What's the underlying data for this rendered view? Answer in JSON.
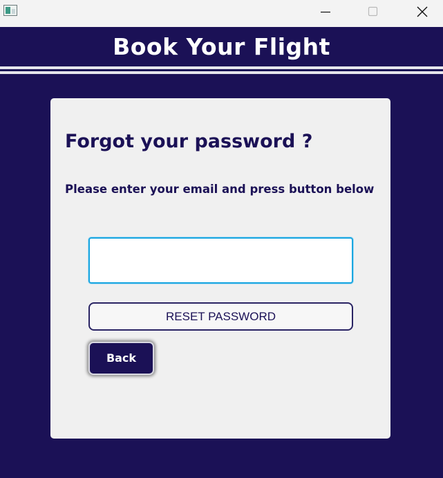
{
  "window": {
    "controls": {
      "minimize_icon": "minimize-icon",
      "maximize_icon": "maximize-icon",
      "close_icon": "close-icon"
    }
  },
  "header": {
    "title": "Book Your Flight"
  },
  "card": {
    "heading": "Forgot your password ?",
    "subtitle": "Please enter your email and press button below",
    "email": {
      "value": "",
      "placeholder": ""
    },
    "reset_label": "RESET PASSWORD",
    "back_label": "Back"
  },
  "colors": {
    "brand_navy": "#1b1156",
    "card_background": "#f0f0f0",
    "input_focus_border": "#1aa6e0",
    "titlebar_background": "#f3f3f3"
  }
}
